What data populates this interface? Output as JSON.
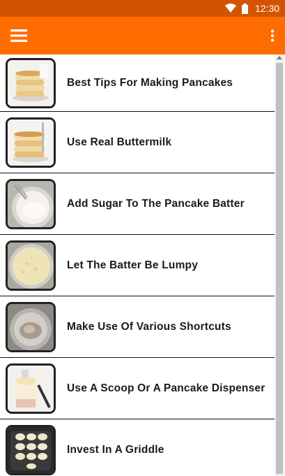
{
  "status_bar": {
    "time": "12:30",
    "icons": [
      "wifi-icon",
      "battery-icon"
    ]
  },
  "app_bar": {
    "menu_icon": "hamburger-menu-icon",
    "overflow_icon": "more-vertical-icon"
  },
  "colors": {
    "status_bar": "#d35400",
    "app_bar": "#ff6d00"
  },
  "list": {
    "items": [
      {
        "label": "Best Tips For Making Pancakes",
        "thumbnail": "pancake-stack-image"
      },
      {
        "label": "Use Real Buttermilk",
        "thumbnail": "pancake-stack-image"
      },
      {
        "label": "Add Sugar To The Pancake Batter",
        "thumbnail": "batter-bowl-image"
      },
      {
        "label": "Let The Batter Be Lumpy",
        "thumbnail": "lumpy-batter-image"
      },
      {
        "label": "Make Use Of Various Shortcuts",
        "thumbnail": "pan-image"
      },
      {
        "label": "Use A Scoop Or A Pancake Dispenser",
        "thumbnail": "dispenser-image"
      },
      {
        "label": "Invest In A Griddle",
        "thumbnail": "griddle-image"
      }
    ]
  }
}
